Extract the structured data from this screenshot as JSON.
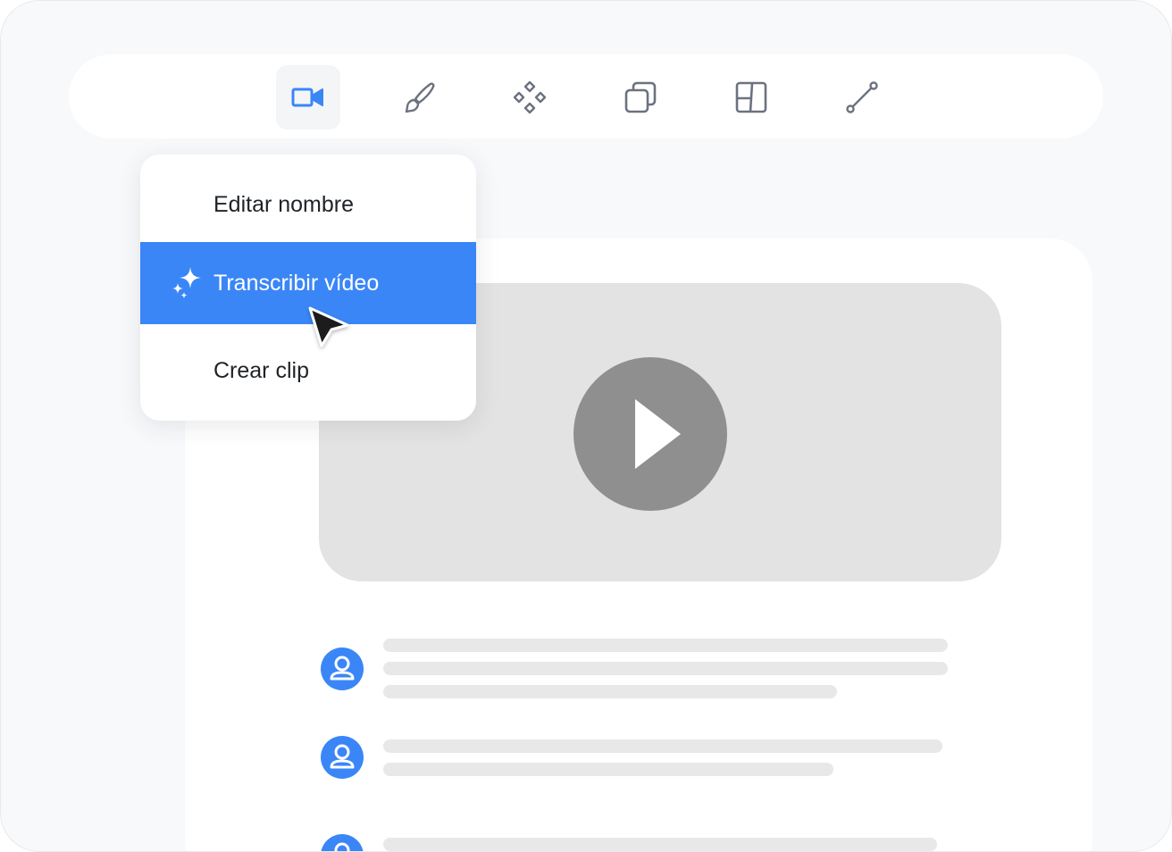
{
  "toolbar": {
    "tools": [
      {
        "icon": "video-camera-icon",
        "active": true
      },
      {
        "icon": "paintbrush-icon",
        "active": false
      },
      {
        "icon": "component-icon",
        "active": false
      },
      {
        "icon": "copy-layers-icon",
        "active": false
      },
      {
        "icon": "layout-icon",
        "active": false
      },
      {
        "icon": "line-connector-icon",
        "active": false
      }
    ]
  },
  "context_menu": {
    "items": [
      {
        "label": "Editar nombre",
        "highlighted": false
      },
      {
        "label": "Transcribir vídeo",
        "highlighted": true,
        "icon": "sparkle-icon"
      },
      {
        "label": "Crear clip",
        "highlighted": false
      }
    ]
  },
  "video_player": {
    "icon": "play-icon"
  },
  "colors": {
    "accent": "#3a86f7",
    "icon_default": "#6b7280",
    "placeholder": "#e8e8e8",
    "video_bg": "#e3e3e3",
    "play_button": "#8f8f8f",
    "avatar": "#3a86f7"
  }
}
